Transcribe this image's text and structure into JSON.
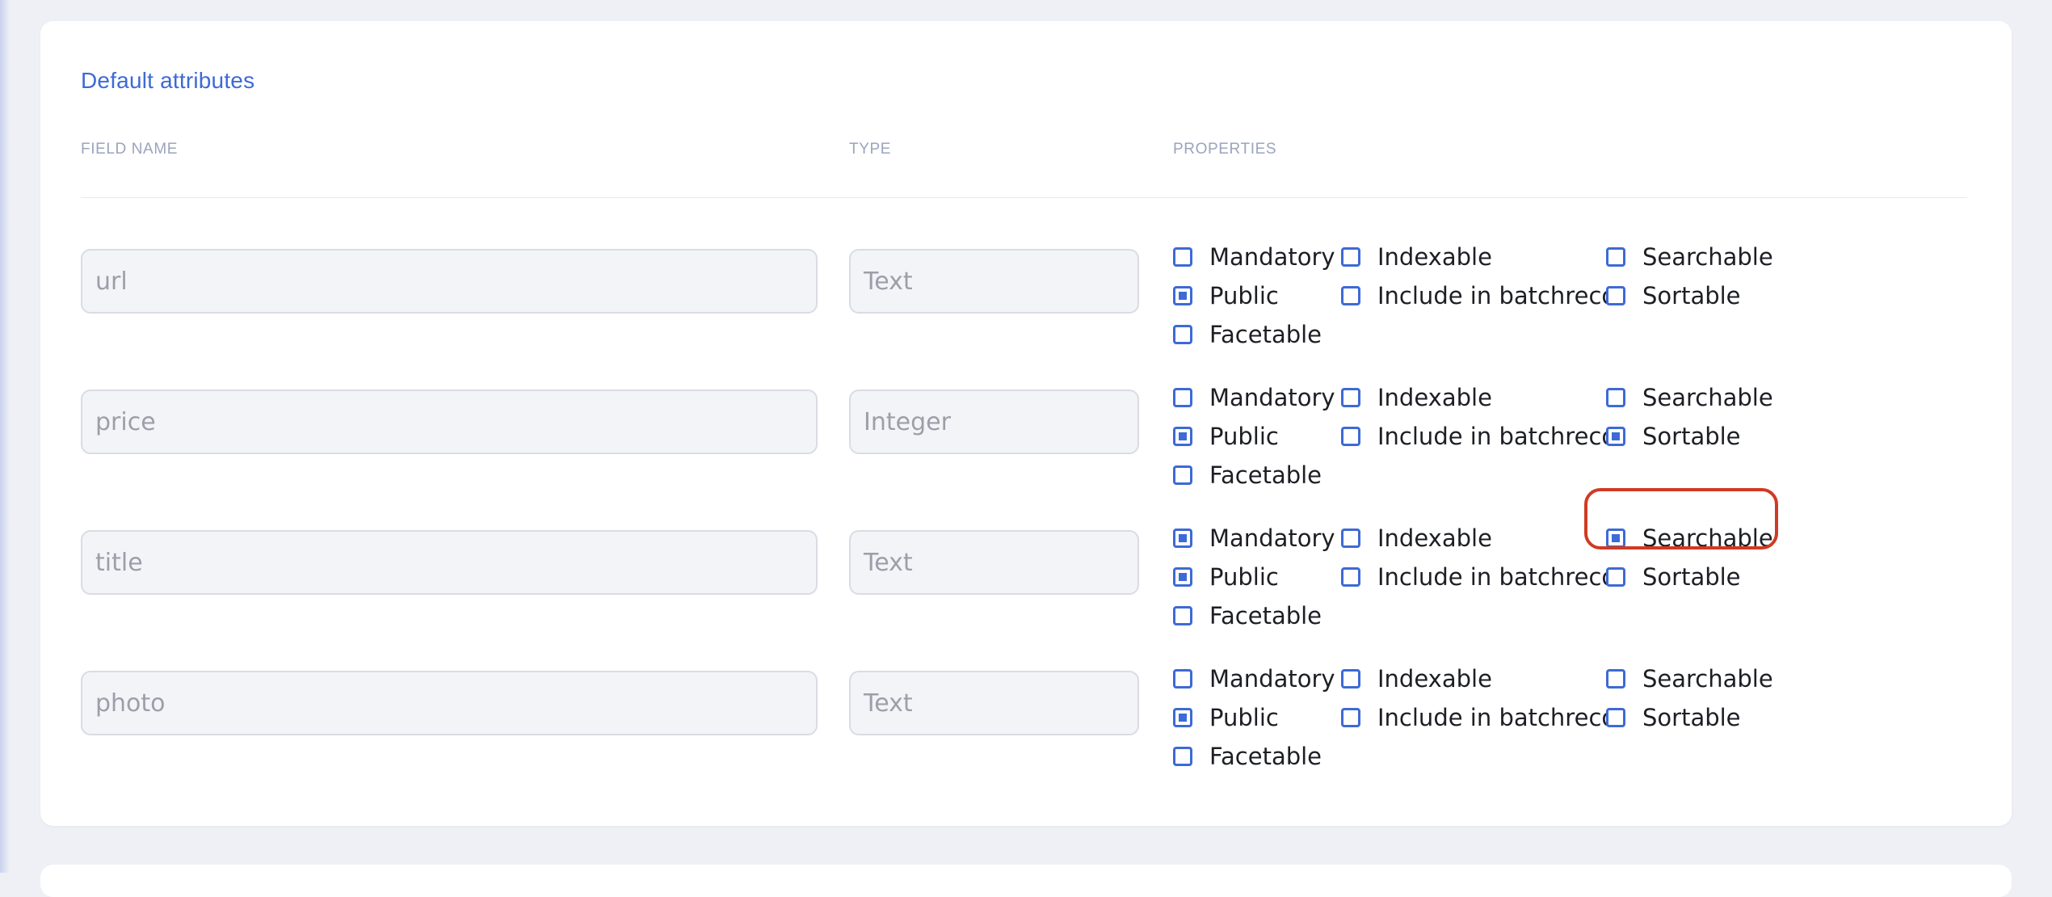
{
  "section": {
    "title": "Default attributes"
  },
  "columns": {
    "field_name": "FIELD NAME",
    "type": "TYPE",
    "properties": "PROPERTIES"
  },
  "property_labels": {
    "mandatory": "Mandatory",
    "indexable": "Indexable",
    "searchable": "Searchable",
    "public": "Public",
    "include_in_batchreco": "Include in batchreco",
    "sortable": "Sortable",
    "facetable": "Facetable"
  },
  "rows": [
    {
      "name": "url",
      "type": "Text",
      "checked": {
        "mandatory": false,
        "indexable": false,
        "searchable": false,
        "public": true,
        "include_in_batchreco": false,
        "sortable": false,
        "facetable": false
      }
    },
    {
      "name": "price",
      "type": "Integer",
      "checked": {
        "mandatory": false,
        "indexable": false,
        "searchable": false,
        "public": true,
        "include_in_batchreco": false,
        "sortable": true,
        "facetable": false
      }
    },
    {
      "name": "title",
      "type": "Text",
      "checked": {
        "mandatory": true,
        "indexable": false,
        "searchable": true,
        "public": true,
        "include_in_batchreco": false,
        "sortable": false,
        "facetable": false
      }
    },
    {
      "name": "photo",
      "type": "Text",
      "checked": {
        "mandatory": false,
        "indexable": false,
        "searchable": false,
        "public": true,
        "include_in_batchreco": false,
        "sortable": false,
        "facetable": false
      }
    }
  ],
  "colors": {
    "accent": "#3d6ad6",
    "highlight": "#d03a23"
  }
}
